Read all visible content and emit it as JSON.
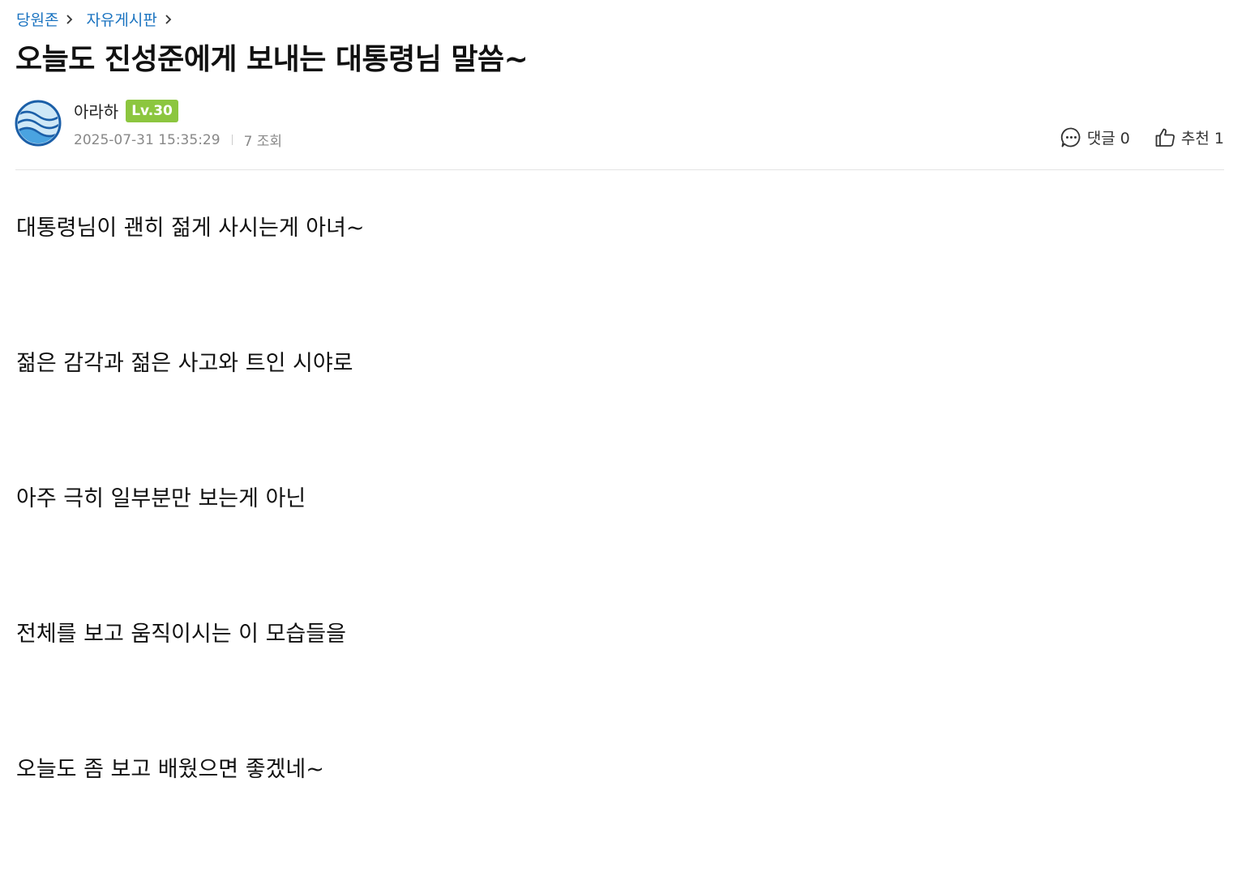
{
  "breadcrumb": {
    "items": [
      "당원존",
      "자유게시판"
    ]
  },
  "post": {
    "title": "오늘도 진성준에게 보내는 대통령님 말씀~",
    "author": {
      "name": "아라하",
      "level": "Lv.30"
    },
    "datetime": "2025-07-31 15:35:29",
    "views": "7 조회",
    "comments_label": "댓글 0",
    "likes_label": "추천 1",
    "body": [
      "대통령님이 괜히 젊게 사시는게 아녀~",
      "젊은 감각과 젊은 사고와 트인 시야로",
      "아주 극히 일부분만 보는게 아닌",
      "전체를 보고 움직이시는 이 모습들을",
      "오늘도 좀 보고 배웠으면 좋겠네~"
    ]
  },
  "icons": {
    "chevron": "chevron-right-icon",
    "comment": "comment-bubble-icon",
    "like": "thumbs-up-icon",
    "avatar": "wave-avatar"
  },
  "colors": {
    "breadcrumb": "#1a73c0",
    "level_badge": "#8cc63f",
    "avatar_ring": "#1b5fa8",
    "avatar_fill": "#d6ecf8"
  }
}
